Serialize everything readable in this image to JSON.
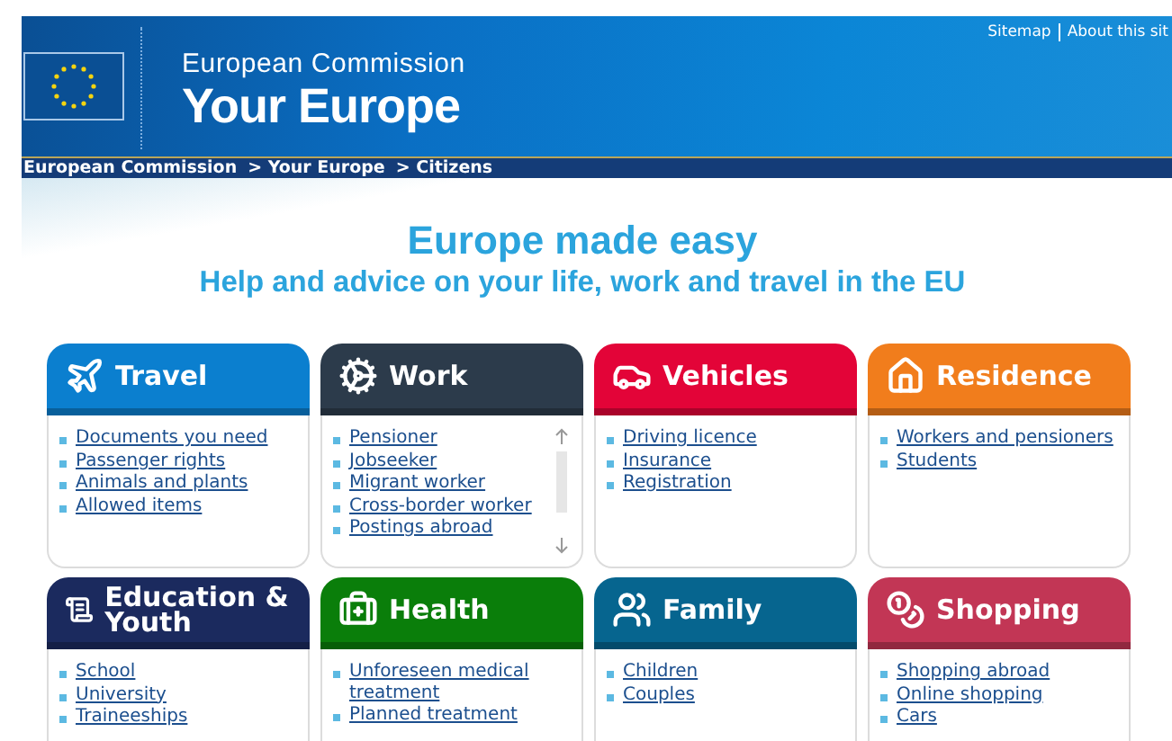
{
  "top_links": [
    "Sitemap",
    "About this sit"
  ],
  "header": {
    "organisation": "European Commission",
    "site_title": "Your Europe"
  },
  "breadcrumb": [
    "European Commission",
    "> Your Europe",
    "> Citizens"
  ],
  "headline": "Europe made easy",
  "subtitle": "Help and advice on your life, work and travel in the EU",
  "cards": [
    {
      "title": "Travel",
      "color": "#0b7fcf",
      "links": [
        "Documents you need",
        "Passenger rights",
        "Animals and plants",
        "Allowed items"
      ]
    },
    {
      "title": "Work",
      "color": "#2c3b4b",
      "links": [
        "Pensioner",
        "Jobseeker",
        "Migrant worker",
        "Cross-border worker",
        "Postings abroad"
      ]
    },
    {
      "title": "Vehicles",
      "color": "#e30438",
      "links": [
        "Driving licence",
        "Insurance",
        "Registration"
      ]
    },
    {
      "title": "Residence",
      "color": "#f17d1c",
      "links": [
        "Workers and pensioners",
        "Students"
      ]
    },
    {
      "title": "Education & Youth",
      "color": "#1b2a5e",
      "links": [
        "School",
        "University",
        "Traineeships"
      ]
    },
    {
      "title": "Health",
      "color": "#0a7e0a",
      "links": [
        "Unforeseen medical treatment",
        "Planned treatment"
      ]
    },
    {
      "title": "Family",
      "color": "#06658f",
      "links": [
        "Children",
        "Couples"
      ]
    },
    {
      "title": "Shopping",
      "color": "#c23655",
      "links": [
        "Shopping abroad",
        "Online shopping",
        "Cars"
      ]
    }
  ]
}
